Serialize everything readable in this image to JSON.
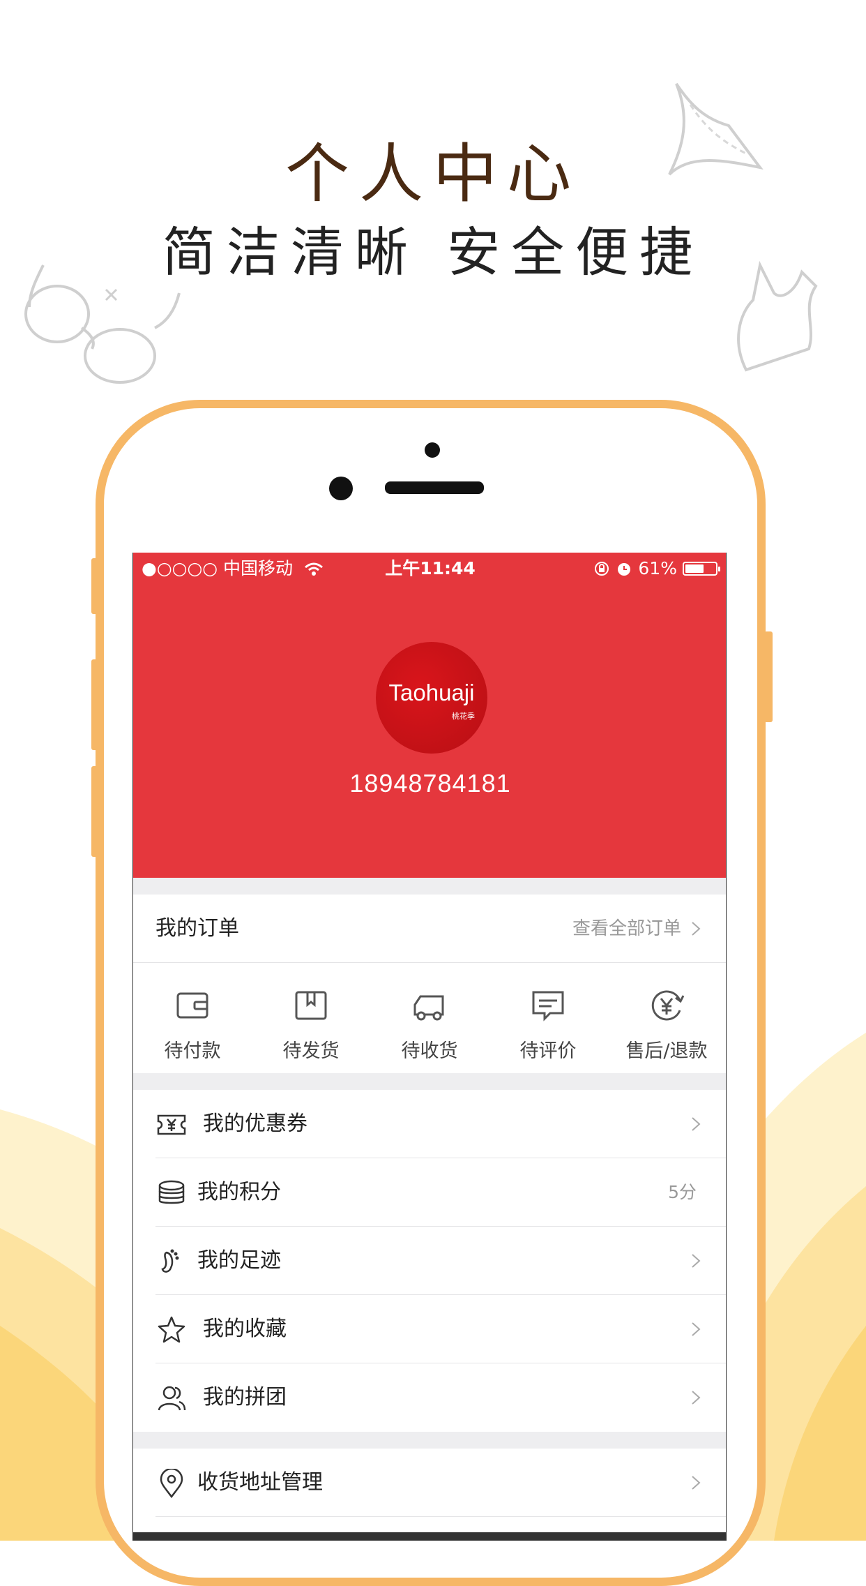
{
  "headline": {
    "title": "个人中心",
    "subtitle": "简洁清晰 安全便捷"
  },
  "colors": {
    "title": "#4a2a12",
    "phone_frame": "#f6b766",
    "hero": "#e5373d",
    "avatar": "#d9151b",
    "wave_light": "#fde9b2",
    "wave_mid": "#fbd67a"
  },
  "status_bar": {
    "carrier": "●○○○○ 中国移动",
    "time": "上午11:44",
    "battery": "61%",
    "battery_level": 0.61
  },
  "profile": {
    "avatar_brand": "Taohuaji",
    "avatar_sub": "桃花季",
    "phone": "18948784181"
  },
  "orders": {
    "title": "我的订单",
    "view_all": "查看全部订单",
    "items": [
      {
        "label": "待付款",
        "icon": "wallet-icon"
      },
      {
        "label": "待发货",
        "icon": "box-icon"
      },
      {
        "label": "待收货",
        "icon": "truck-icon"
      },
      {
        "label": "待评价",
        "icon": "comment-icon"
      },
      {
        "label": "售后/退款",
        "icon": "refund-icon"
      }
    ]
  },
  "menu": [
    {
      "label": "我的优惠券",
      "icon": "coupon-icon",
      "value": ""
    },
    {
      "label": "我的积分",
      "icon": "coins-icon",
      "value": "5分"
    },
    {
      "label": "我的足迹",
      "icon": "footprint-icon",
      "value": ""
    },
    {
      "label": "我的收藏",
      "icon": "star-icon",
      "value": ""
    },
    {
      "label": "我的拼团",
      "icon": "group-icon",
      "value": ""
    }
  ],
  "menu2": [
    {
      "label": "收货地址管理",
      "icon": "location-icon"
    }
  ]
}
